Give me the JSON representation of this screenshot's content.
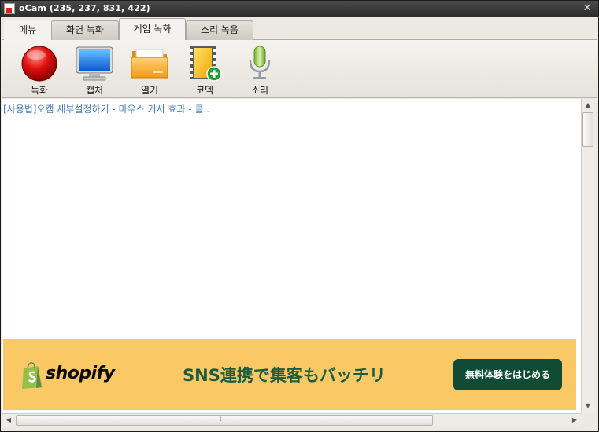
{
  "window": {
    "title": "oCam (235, 237, 831, 422)",
    "minimize_glyph": "_",
    "close_glyph": "✕"
  },
  "tabs": [
    {
      "label": "메뉴",
      "active": false
    },
    {
      "label": "화면 녹화",
      "active": false
    },
    {
      "label": "게임 녹화",
      "active": true
    },
    {
      "label": "소리 녹음",
      "active": false
    }
  ],
  "toolbar": {
    "record": {
      "label": "녹화",
      "icon": "record-icon"
    },
    "capture": {
      "label": "캡처",
      "icon": "monitor-icon"
    },
    "open": {
      "label": "열기",
      "icon": "folder-icon"
    },
    "codec": {
      "label": "코덱",
      "icon": "film-add-icon"
    },
    "sound": {
      "label": "소리",
      "icon": "microphone-icon"
    }
  },
  "content": {
    "article_link": "[사용법]오캠 세부설정하기 - 마우스 커서 효과 - 클.."
  },
  "ad": {
    "logo_text": "shopify",
    "tagline": "SNS連携で集客もバッチリ",
    "cta": "無料体験をはじめる",
    "colors": {
      "background": "#fbc866",
      "text": "#1d5d3f",
      "button": "#0f4b35"
    }
  }
}
